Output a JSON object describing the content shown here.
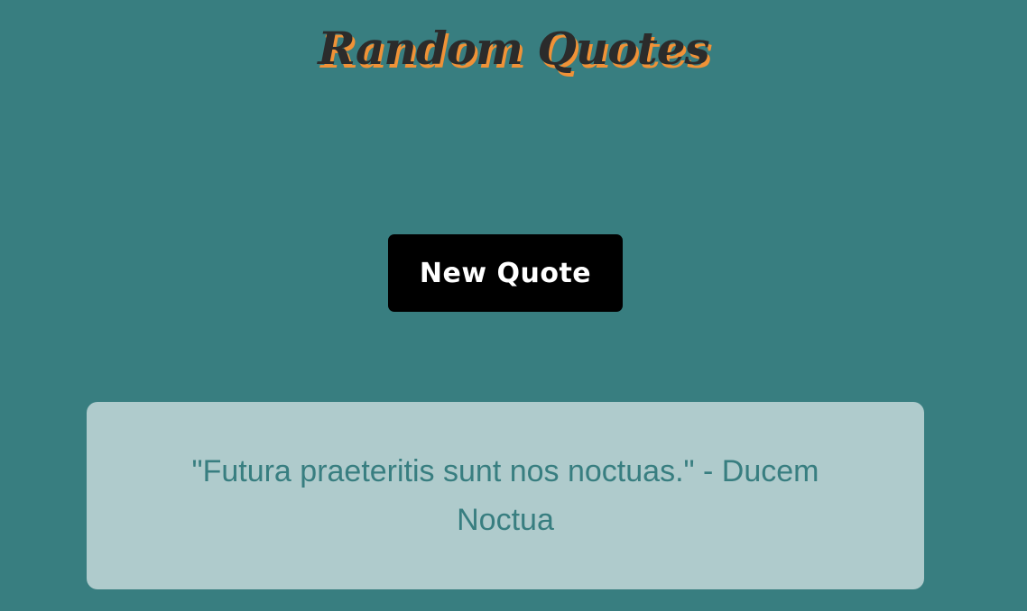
{
  "header": {
    "title": "Random Quotes"
  },
  "controls": {
    "new_quote_label": "New Quote"
  },
  "quote": {
    "text": "\"Futura praeteritis sunt nos noctuas.\" - Ducem Noctua"
  },
  "colors": {
    "background": "#387e80",
    "title": "#2b2b2b",
    "title_shadow": "#f09237",
    "button_bg": "#000000",
    "button_text": "#ffffff",
    "card_bg": "#afcbcc",
    "quote_text": "#387e80"
  }
}
